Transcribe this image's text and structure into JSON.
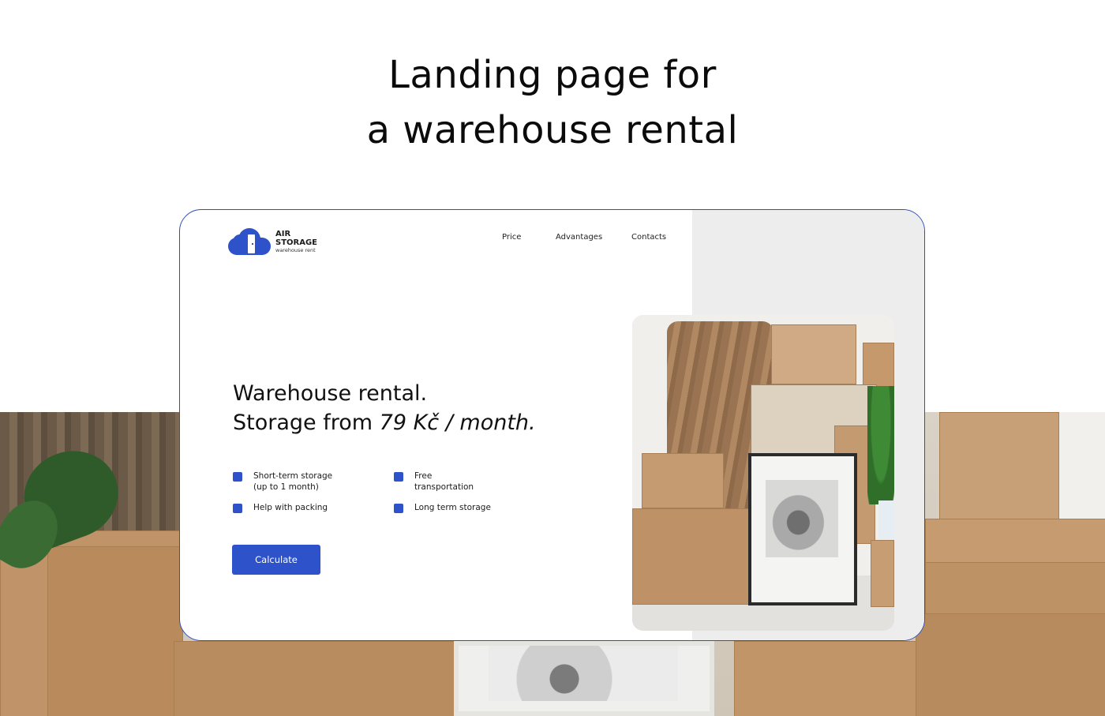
{
  "headline": {
    "line1": "Landing page for",
    "line2": "a warehouse rental"
  },
  "logo": {
    "line1": "AIR",
    "line2": "STORAGE",
    "tagline": "warehouse rent",
    "icon": "cloud-door-icon",
    "color": "#2d52c9"
  },
  "nav": {
    "items": [
      "Price",
      "Advantages",
      "Contacts"
    ]
  },
  "hero": {
    "title_line1": "Warehouse rental.",
    "title_prefix": "Storage from ",
    "title_price": "79 Kč / month."
  },
  "features": [
    "Short-term storage\n(up to 1 month)",
    "Free\ntransportation",
    "Help with packing",
    "Long term storage"
  ],
  "cta": {
    "label": "Calculate"
  },
  "colors": {
    "accent": "#2d52c9",
    "card_border": "#2f4fb8",
    "panel_gray": "#ededed"
  }
}
